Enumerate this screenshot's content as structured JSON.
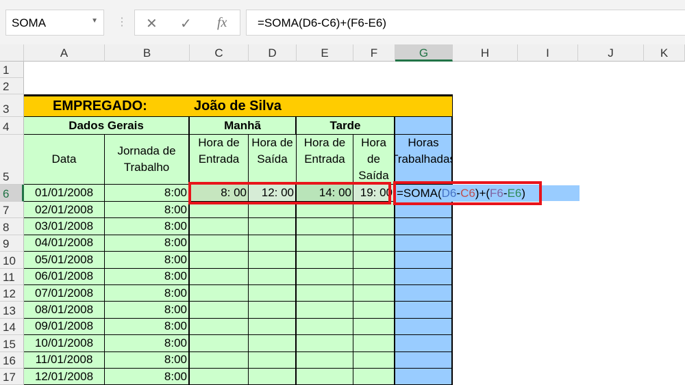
{
  "name_box": "SOMA",
  "formula_buttons": {
    "cancel": "✕",
    "enter": "✓",
    "fx": "fx"
  },
  "formula": "=SOMA(D6-C6)+(F6-E6)",
  "columns": [
    "A",
    "B",
    "C",
    "D",
    "E",
    "F",
    "G",
    "H",
    "I",
    "J",
    "K"
  ],
  "rows": [
    "1",
    "2",
    "3",
    "4",
    "5",
    "6",
    "7",
    "8",
    "9",
    "10",
    "11",
    "12",
    "13",
    "14",
    "15",
    "16",
    "17"
  ],
  "title": {
    "label": "EMPREGADO:",
    "name": "João de Silva"
  },
  "groups": {
    "dados": "Dados Gerais",
    "manha": "Manhã",
    "tarde": "Tarde"
  },
  "headers": {
    "data": "Data",
    "jornada": "Jornada de Trabalho",
    "entrada": "Hora de Entrada",
    "saida": "Hora de Saída",
    "horas": "Horas Trabalhadas"
  },
  "row6": {
    "c": "8: 00",
    "d": "12: 00",
    "e": "14: 00",
    "f": "19: 00"
  },
  "formula_parts": {
    "p1": "=SOMA(",
    "d6": "D6",
    "m1": "-",
    "c6": "C6",
    "p2": ")+(",
    "f6": "F6",
    "m2": "-",
    "e6": "E6",
    "p3": ")"
  },
  "colors": {
    "d6": "#4472c4",
    "c6": "#c0504d",
    "f6": "#8064a2",
    "e6": "#2e8b57"
  },
  "data_rows": [
    {
      "date": "01/01/2008",
      "jornada": "8:00"
    },
    {
      "date": "02/01/2008",
      "jornada": "8:00"
    },
    {
      "date": "03/01/2008",
      "jornada": "8:00"
    },
    {
      "date": "04/01/2008",
      "jornada": "8:00"
    },
    {
      "date": "05/01/2008",
      "jornada": "8:00"
    },
    {
      "date": "06/01/2008",
      "jornada": "8:00"
    },
    {
      "date": "07/01/2008",
      "jornada": "8:00"
    },
    {
      "date": "08/01/2008",
      "jornada": "8:00"
    },
    {
      "date": "09/01/2008",
      "jornada": "8:00"
    },
    {
      "date": "10/01/2008",
      "jornada": "8:00"
    },
    {
      "date": "11/01/2008",
      "jornada": "8:00"
    },
    {
      "date": "12/01/2008",
      "jornada": "8:00"
    }
  ]
}
